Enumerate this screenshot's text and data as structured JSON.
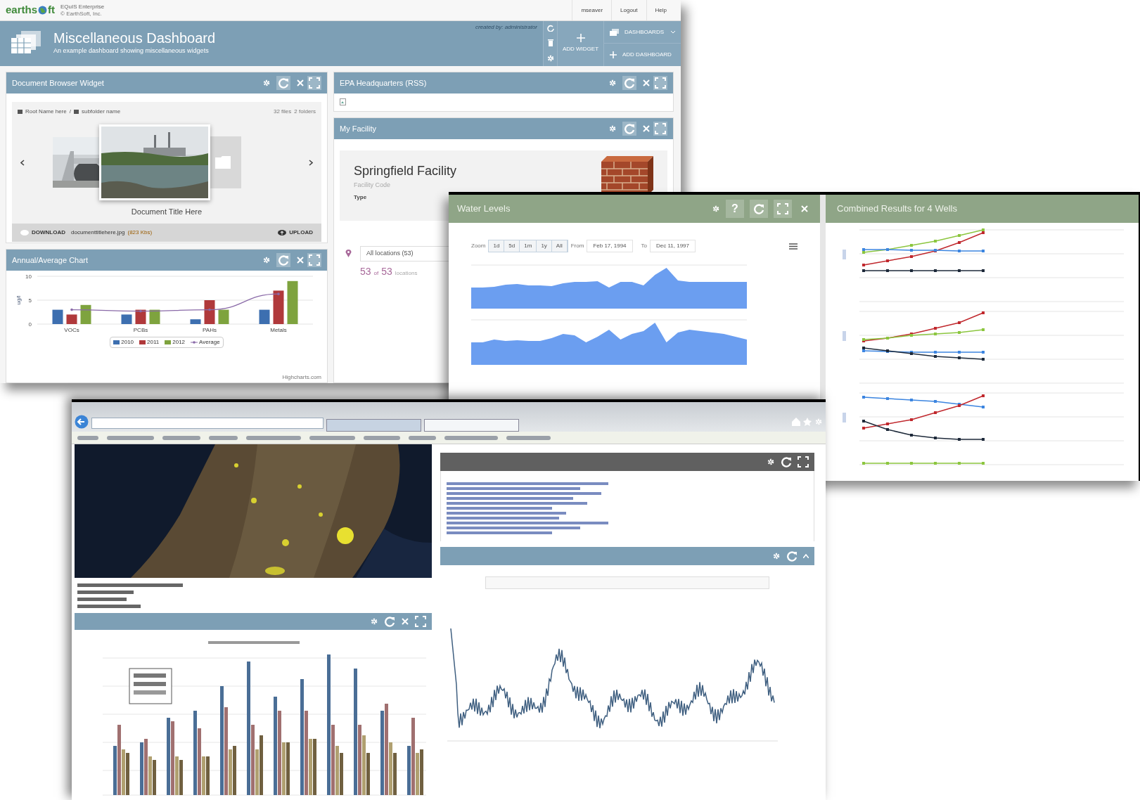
{
  "dashboard_screenshot": {
    "header": {
      "logo_start": "earths",
      "logo_end": "ft",
      "product": "EQuIS Enterprise",
      "copyright": "© EarthSoft, Inc.",
      "links": [
        "mseaver",
        "Logout",
        "Help"
      ]
    },
    "banner": {
      "title": "Miscellaneous Dashboard",
      "subtitle": "An example dashboard showing miscellaneous widgets",
      "created_by": "created by: administrator",
      "add_widget": "ADD WIDGET",
      "dashboards": "DASHBOARDS",
      "add_dashboard": "ADD DASHBOARD"
    },
    "document_browser": {
      "title": "Document Browser Widget",
      "breadcrumb": [
        "Root Name here",
        "subfolder name"
      ],
      "separator": "/",
      "counts": [
        "32 files",
        "2 folders"
      ],
      "document_title": "Document Title Here",
      "download": "DOWNLOAD",
      "file_name": "documenttitlehere.jpg",
      "file_size": "(823 Kbs)",
      "upload": "UPLOAD"
    },
    "annual_chart": {
      "title": "Annual/Average Chart",
      "credit": "Highcharts.com",
      "chart_data": {
        "type": "bar",
        "ylabel": "ug/l",
        "categories": [
          "VOCs",
          "PCBs",
          "PAHs",
          "Metals"
        ],
        "legend": "bottom",
        "ylim": [
          0,
          10
        ],
        "yticks": [
          0,
          5,
          10
        ],
        "series": [
          {
            "name": "2010",
            "color": "#3d6fb0",
            "type": "bar",
            "values": [
              3,
              2,
              1,
              3
            ]
          },
          {
            "name": "2011",
            "color": "#b0393b",
            "type": "bar",
            "values": [
              2,
              3,
              5,
              7
            ]
          },
          {
            "name": "2012",
            "color": "#7ea33e",
            "type": "bar",
            "values": [
              4,
              3,
              3,
              9
            ]
          },
          {
            "name": "Average",
            "color": "#8a6aa8",
            "type": "line",
            "values": [
              3,
              2.7,
              3,
              6.3
            ]
          }
        ]
      }
    },
    "rss": {
      "title": "EPA Headquarters (RSS)"
    },
    "facility": {
      "title": "My Facility",
      "name": "Springfield Facility",
      "code": "Facility Code",
      "type": "Type",
      "location_select": "All locations (53)",
      "count": "53",
      "of": "of",
      "total": "53",
      "unit": "locations"
    }
  },
  "wells_screenshot": {
    "water_levels": {
      "title": "Water Levels",
      "help": "?",
      "zoom_label": "Zoom",
      "ranges": [
        "1d",
        "5d",
        "1m",
        "1y",
        "All"
      ],
      "from_label": "From",
      "from": "Feb 17, 1994",
      "to_label": "To",
      "to": "Dec 11, 1997"
    },
    "combined": {
      "title": "Combined Results for 4 Wells"
    }
  }
}
